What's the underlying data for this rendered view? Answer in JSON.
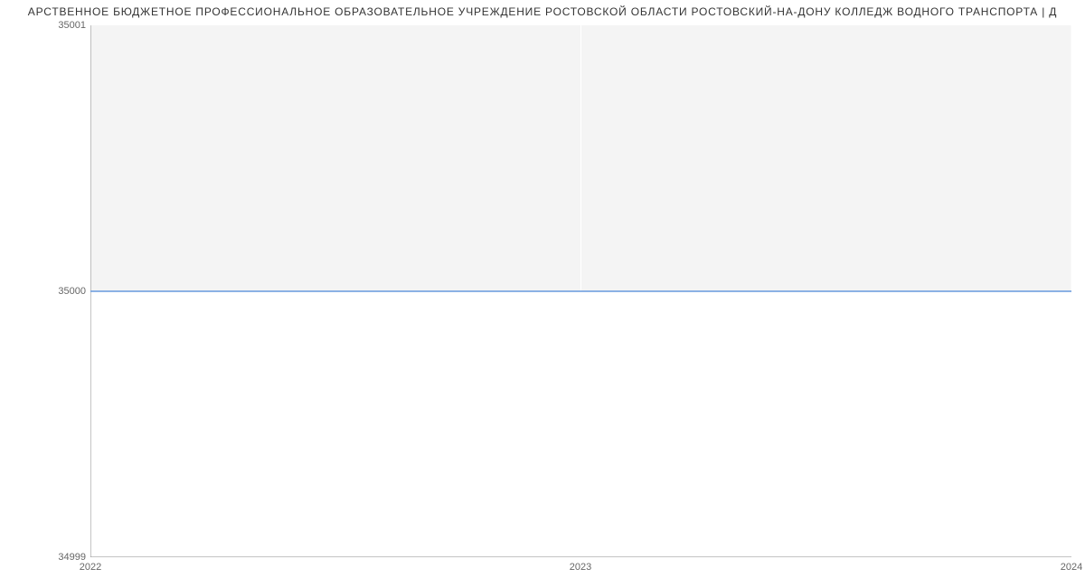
{
  "chart_data": {
    "type": "line",
    "title": "АРСТВЕННОЕ БЮДЖЕТНОЕ ПРОФЕССИОНАЛЬНОЕ ОБРАЗОВАТЕЛЬНОЕ УЧРЕЖДЕНИЕ  РОСТОВСКОЙ ОБЛАСТИ РОСТОВСКИЙ-НА-ДОНУ КОЛЛЕДЖ ВОДНОГО ТРАНСПОРТА | Д",
    "x": [
      2022,
      2023,
      2024
    ],
    "values": [
      35000,
      35000,
      35000
    ],
    "xlabel": "",
    "ylabel": "",
    "xlim": [
      2022,
      2024
    ],
    "ylim": [
      34999,
      35001
    ],
    "x_ticks": [
      2022,
      2023,
      2024
    ],
    "y_ticks": [
      34999,
      35000,
      35001
    ],
    "grid": true,
    "line_color": "#6699dd",
    "grid_color": "#f4f4f4"
  }
}
